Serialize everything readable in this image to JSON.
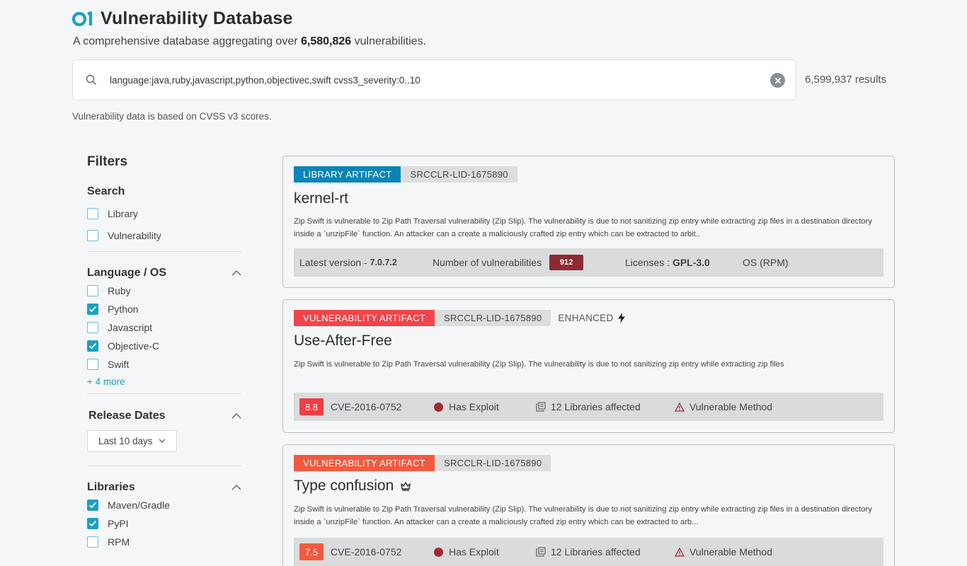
{
  "header": {
    "title": "Vulnerability Database",
    "subtitle_prefix": "A comprehensive database aggregating over ",
    "subtitle_count": "6,580,826",
    "subtitle_suffix": " vulnerabilities."
  },
  "search": {
    "query": "language:java,ruby,javascript,python,objectivec,swift cvss3_severity:0..10",
    "results": "6,599,937 results"
  },
  "note": "Vulnerability data is based on CVSS v3 scores.",
  "colors": {
    "accent": "#1aa0c2",
    "library": "#0a85b8",
    "vuln": "#f0454b",
    "badge": "#8e2a32"
  },
  "filters": {
    "title": "Filters",
    "search": {
      "title": "Search",
      "options": [
        {
          "label": "Library",
          "checked": false
        },
        {
          "label": "Vulnerability",
          "checked": false
        }
      ]
    },
    "language": {
      "title": "Language / OS",
      "options": [
        {
          "label": "Ruby",
          "checked": false
        },
        {
          "label": "Python",
          "checked": true
        },
        {
          "label": "Javascript",
          "checked": false
        },
        {
          "label": "Objective-C",
          "checked": true
        },
        {
          "label": "Swift",
          "checked": false
        }
      ],
      "more": "+ 4 more"
    },
    "release": {
      "title": "Release Dates",
      "selected": "Last 10 days"
    },
    "libraries": {
      "title": "Libraries",
      "options": [
        {
          "label": "Maven/Gradle",
          "checked": true
        },
        {
          "label": "PyPI",
          "checked": true
        },
        {
          "label": "RPM",
          "checked": false
        }
      ]
    }
  },
  "cards": [
    {
      "type": "LIBRARY ARTIFACT",
      "id": "SRCCLR-LID-1675890",
      "title": "kernel-rt",
      "desc": "Zip Swift is vulnerable to Zip Path Traversal vulnerability (Zip Slip). The vulnerability is due to not sanitizing zip entry while extracting zip files in a destination directory inside a `unzipFile` function. An attacker can a create a maliciously crafted zip entry which can be extracted to arbit..",
      "latest_label": "Latest version",
      "latest_value": "7.0.7.2",
      "vulns_label": "Number of vulnerabilities",
      "vulns_value": "912",
      "licenses_label": "Licenses :",
      "licenses_value": "GPL-3.0",
      "os": "OS (RPM)"
    },
    {
      "type": "VULNERABILITY ARTIFACT",
      "id": "SRCCLR-LID-1675890",
      "enhanced": "ENHANCED",
      "title": "Use-After-Free",
      "desc": "Zip Swift is vulnerable to Zip Path Traversal vulnerability (Zip Slip). The vulnerability is due to not sanitizing zip entry while extracting zip files",
      "score": "8.8",
      "score_color": "#ef3e46",
      "cve": "CVE-2016-0752",
      "exploit": "Has Exploit",
      "libraries": "12 Libraries affected",
      "method": "Vulnerable Method"
    },
    {
      "type": "VULNERABILITY ARTIFACT",
      "id": "SRCCLR-LID-1675890",
      "title": "Type confusion",
      "desc": "Zip Swift is vulnerable to Zip Path Traversal vulnerability (Zip Slip). The vulnerability is due to not sanitizing zip entry while extracting zip files in a destination directory inside a `unzipFile` function. An attacker can a create a maliciously crafted zip entry which can be extracted to arb...",
      "score": "7.5",
      "score_color": "#f25a40",
      "cve": "CVE-2016-0752",
      "exploit": "Has Exploit",
      "libraries": "12 Libraries affected",
      "method": "Vulnerable Method"
    }
  ]
}
